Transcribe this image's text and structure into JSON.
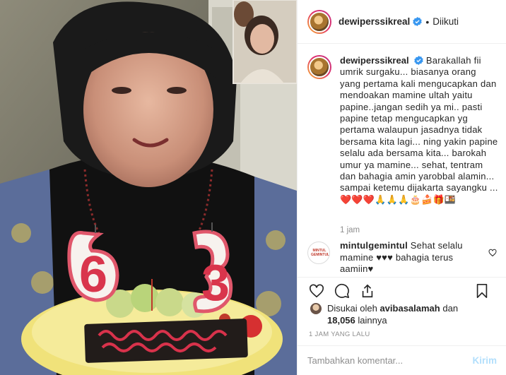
{
  "header": {
    "username": "dewiperssikreal",
    "follow_status": "Diikuti",
    "separator": "•"
  },
  "caption": {
    "username": "dewiperssikreal",
    "text": "Barakallah fii umrik surgaku... biasanya orang yang pertama kali mengucapkan dan mendoakan mamine ultah yaitu papine..jangan sedih ya mi.. pasti papine tetap mengucapkan yg pertama walaupun jasadnya tidak bersama kita lagi... ning yakin papine selalu ada bersama kita... barokah umur ya mamine... sehat, tentram dan bahagia amin yarobbal alamin... sampai ketemu dijakarta sayangku ... ❤️❤️❤️🙏🙏🙏🎂🍰🎁🍱",
    "time": "1 jam"
  },
  "comment": {
    "username": "mintulgemintul",
    "text": "Sehat selalu mamine ♥♥♥ bahagia terus aamiin♥",
    "avatar_label": "MINTUL GEMINTUL"
  },
  "likes": {
    "prefix": "Disukai oleh",
    "user": "avibasalamah",
    "middle": "dan",
    "count": "18,056",
    "suffix": "lainnya"
  },
  "timestamp": "1 JAM YANG LALU",
  "add_comment": {
    "placeholder": "Tambahkan komentar...",
    "post_label": "Kirim"
  },
  "photo": {
    "candle_left": "6",
    "candle_right": "3"
  },
  "icons": {
    "like": "heart-icon",
    "comment": "comment-icon",
    "share": "share-icon",
    "save": "bookmark-icon",
    "verified": "verified-badge-icon"
  },
  "colors": {
    "verified": "#3897f0",
    "muted": "#8e8e8e",
    "post_button": "#b2dffc",
    "border": "#efefef"
  }
}
